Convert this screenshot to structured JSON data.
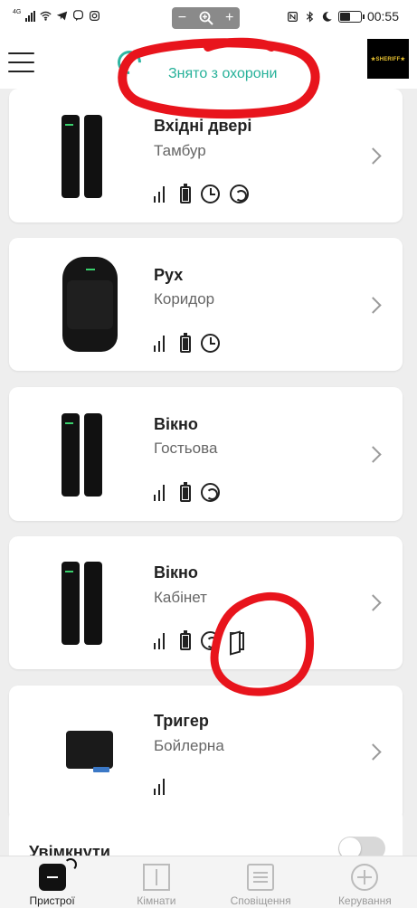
{
  "status_bar": {
    "network": "4G",
    "time": "00:55",
    "zoom_minus": "−",
    "zoom_plus": "+"
  },
  "header": {
    "arm_status": "Знято з охорони",
    "hub_logo_text": "★SHERIFF★",
    "accent_color": "#26b199"
  },
  "devices": [
    {
      "name": "Вхідні двері",
      "room": "Тамбур",
      "image": "door-contact",
      "status_icons": [
        "signal-icon",
        "battery-icon",
        "clock-icon",
        "cycle-icon"
      ]
    },
    {
      "name": "Рух",
      "room": "Коридор",
      "image": "motion-detector",
      "status_icons": [
        "signal-icon",
        "battery-icon",
        "clock-icon"
      ]
    },
    {
      "name": "Вікно",
      "room": "Гостьова",
      "image": "door-contact",
      "status_icons": [
        "signal-icon",
        "battery-icon",
        "cycle-icon"
      ]
    },
    {
      "name": "Вікно",
      "room": "Кабінет",
      "image": "door-contact",
      "status_icons": [
        "signal-icon",
        "battery-icon",
        "cycle-icon",
        "door-open-icon"
      ]
    },
    {
      "name": "Тригер",
      "room": "Бойлерна",
      "image": "relay",
      "status_icons": [
        "signal-icon"
      ]
    }
  ],
  "setting": {
    "label": "Увімкнути",
    "toggle_on": false
  },
  "bottom_nav": [
    {
      "label": "Пристрої",
      "icon": "devices-icon",
      "active": true
    },
    {
      "label": "Кімнати",
      "icon": "rooms-icon",
      "active": false
    },
    {
      "label": "Сповіщення",
      "icon": "notifications-icon",
      "active": false
    },
    {
      "label": "Керування",
      "icon": "control-icon",
      "active": false
    }
  ],
  "annotation_color": "#e8141c"
}
